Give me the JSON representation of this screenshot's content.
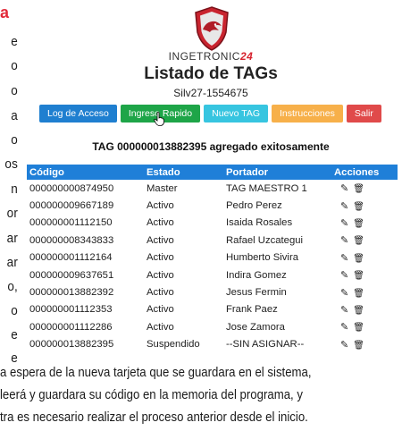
{
  "doc": {
    "corner_heading": "a",
    "side_words": [
      "e",
      "o",
      "o",
      "a",
      "o",
      "os",
      "n",
      "or",
      "ar",
      "ar",
      "o,",
      "o",
      "e",
      "e"
    ],
    "bottom_lines": [
      "a espera de la nueva tarjeta que se guardara en el sistema,",
      "leerá y guardara su código en la memoria del programa, y",
      "tra es necesario realizar el proceso anterior desde el inicio."
    ]
  },
  "app": {
    "brand_text": "INGETRONIC",
    "brand_num": "24",
    "title": "Listado de TAGs",
    "serial": "Silv27-1554675",
    "buttons": [
      {
        "label": "Log de Acceso",
        "color": "#1f7fd0"
      },
      {
        "label": "Ingreso Rapido",
        "color": "#1ea548"
      },
      {
        "label": "Nuevo TAG",
        "color": "#37c5e0"
      },
      {
        "label": "Instrucciones",
        "color": "#f7b04a"
      },
      {
        "label": "Salir",
        "color": "#e04a4a"
      }
    ],
    "status_message": "TAG 000000013882395 agregado exitosamente",
    "table": {
      "headers": {
        "codigo": "Código",
        "estado": "Estado",
        "portador": "Portador",
        "acciones": "Acciones"
      },
      "rows": [
        {
          "codigo": "000000000874950",
          "estado": "Master",
          "portador": "TAG MAESTRO 1"
        },
        {
          "codigo": "000000009667189",
          "estado": "Activo",
          "portador": "Pedro Perez"
        },
        {
          "codigo": "000000001112150",
          "estado": "Activo",
          "portador": "Isaida Rosales"
        },
        {
          "codigo": "000000008343833",
          "estado": "Activo",
          "portador": "Rafael Uzcategui"
        },
        {
          "codigo": "000000001112164",
          "estado": "Activo",
          "portador": "Humberto Sivira"
        },
        {
          "codigo": "000000009637651",
          "estado": "Activo",
          "portador": "Indira Gomez"
        },
        {
          "codigo": "000000013882392",
          "estado": "Activo",
          "portador": "Jesus Fermin"
        },
        {
          "codigo": "000000001112353",
          "estado": "Activo",
          "portador": "Frank Paez"
        },
        {
          "codigo": "000000001112286",
          "estado": "Activo",
          "portador": "Jose Zamora"
        },
        {
          "codigo": "000000013882395",
          "estado": "Suspendido",
          "portador": "--SIN ASIGNAR--"
        }
      ],
      "action_icons": [
        "pencil-icon",
        "trash-icon"
      ]
    }
  }
}
